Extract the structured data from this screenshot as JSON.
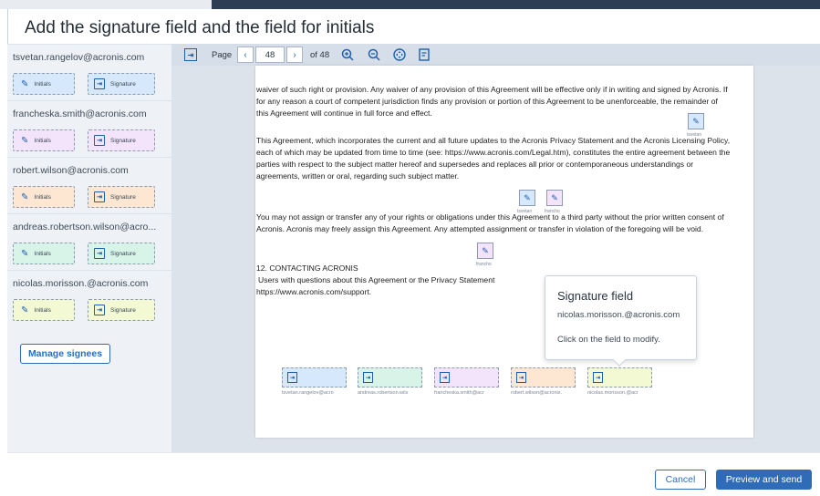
{
  "title": "Add the signature field and the field for initials",
  "colors": {
    "accent": "#2e6cb8",
    "signee_colors": [
      "#d6e8fb",
      "#f3e3fb",
      "#fde7d2",
      "#d8f3e8",
      "#f2f9d3"
    ]
  },
  "sidebar": {
    "signees": [
      {
        "email": "tsvetan.rangelov@acronis.com",
        "initials_label": "Initials",
        "signature_label": "Signature"
      },
      {
        "email": "francheska.smith@acronis.com",
        "initials_label": "Initials",
        "signature_label": "Signature"
      },
      {
        "email": "robert.wilson@acronis.com",
        "initials_label": "Initials",
        "signature_label": "Signature"
      },
      {
        "email": "andreas.robertson.wilson@acro...",
        "initials_label": "Initials",
        "signature_label": "Signature"
      },
      {
        "email": "nicolas.morisson.@acronis.com",
        "initials_label": "Initials",
        "signature_label": "Signature"
      }
    ],
    "manage_label": "Manage signees"
  },
  "toolbar": {
    "fit_icon": "fit-width-icon",
    "page_label": "Page",
    "prev_icon": "chevron-left-icon",
    "page_number": "48",
    "next_icon": "chevron-right-icon",
    "of_total": "of 48",
    "zoom_in_icon": "zoom-in-icon",
    "zoom_out_icon": "zoom-out-icon",
    "move_icon": "move-icon",
    "doc_icon": "document-icon"
  },
  "document": {
    "p1": "waiver of such right or provision. Any waiver of any provision of this Agreement will be effective only if in writing and signed by Acronis. If for any reason a court of competent jurisdiction finds any provision or portion of this Agreement to be unenforceable, the remainder of this Agreement will continue in full force and effect.",
    "p2": "This Agreement, which incorporates the current and all future updates to the Acronis Privacy Statement and the Acronis Licensing Policy, each of which may be updated from time to time (see: https://www.acronis.com/Legal.htm), constitutes the entire agreement between the parties with respect to the subject matter hereof and supersedes and replaces all prior or contemporaneous understandings or agreements, written or oral, regarding such subject matter.",
    "p3": "You may not assign or transfer any of your rights or obligations under this Agreement to a third party without the prior written consent of Acronis. Acronis may freely assign this Agreement. Any attempted assignment or transfer in violation of the foregoing will be void.",
    "heading": "12. CONTACTING ACRONIS",
    "p4": "Users with questions about this Agreement or the Privacy Statement",
    "p5": "https://www.acronis.com/support.",
    "placed_initials": [
      {
        "label": "tsvetan"
      },
      {
        "label": "tsvetan"
      },
      {
        "label": "francho"
      },
      {
        "label": "francho"
      }
    ],
    "signature_fields": [
      {
        "label": "tsvetan.rangelov@acro"
      },
      {
        "label": "andreas.robertson.wils"
      },
      {
        "label": "francheska.smith@acr"
      },
      {
        "label": "robert.wilson@acronis."
      },
      {
        "label": "nicolas.morisson.@acr"
      }
    ]
  },
  "tooltip": {
    "title": "Signature field",
    "email": "nicolas.morisson.@acronis.com",
    "hint": "Click on the field to modify."
  },
  "footer": {
    "cancel_label": "Cancel",
    "send_label": "Preview and send"
  }
}
